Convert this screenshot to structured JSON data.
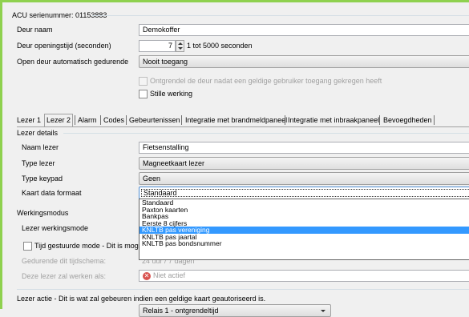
{
  "header": {
    "serial_label": "ACU serienummer: 01153883"
  },
  "door": {
    "name_label": "Deur naam",
    "name_value": "Demokoffer",
    "open_time_label": "Deur openingstijd (seconden)",
    "open_time_value": "7",
    "open_time_range": "1 tot 5000 seconden",
    "auto_open_label": "Open deur automatisch gedurende",
    "auto_open_value": "Nooit toegang",
    "unlock_after_valid_label": "Ontgrendel de deur nadat een geldige gebruiker toegang gekregen heeft",
    "silent_label": "Stille werking"
  },
  "tabs": [
    "Lezer 1",
    "Lezer 2",
    "Alarm",
    "Codes",
    "Gebeurtenissen",
    "Integratie met brandmeldpaneel",
    "Integratie met inbraakpaneel",
    "Bevoegdheden"
  ],
  "active_tab": "Lezer 2",
  "reader": {
    "section_label": "Lezer details",
    "name_label": "Naam lezer",
    "name_value": "Fietsenstalling",
    "type_label": "Type lezer",
    "type_value": "Magneetkaart lezer",
    "keypad_label": "Type keypad",
    "keypad_value": "Geen",
    "format_label": "Kaart data formaat",
    "format_value": "Standaard",
    "format_options": [
      "Standaard",
      "Paxton kaarten",
      "Bankpas",
      "Eerste 8 cijfers",
      "KNLTB pas vereniging",
      "KNLTB pas jaartal",
      "KNLTB pas bondsnummer"
    ],
    "format_highlighted": "KNLTB pas vereniging"
  },
  "working": {
    "section_label": "Werkingsmodus",
    "mode_label": "Lezer werkingsmode",
    "time_mode_label": "Tijd gestuurde mode - Dit is mogelijk",
    "schedule_label": "Gedurende dit tijdschema:",
    "schedule_value": "24 uur / 7 dagen",
    "will_work_label": "Deze lezer zal werken als:",
    "status_value": "Niet actief"
  },
  "action": {
    "label": "Lezer  actie - Dit is wat zal gebeuren indien een geldige kaart geautoriseerd is.",
    "value": "Relais 1 - ontgrendeltijd"
  }
}
